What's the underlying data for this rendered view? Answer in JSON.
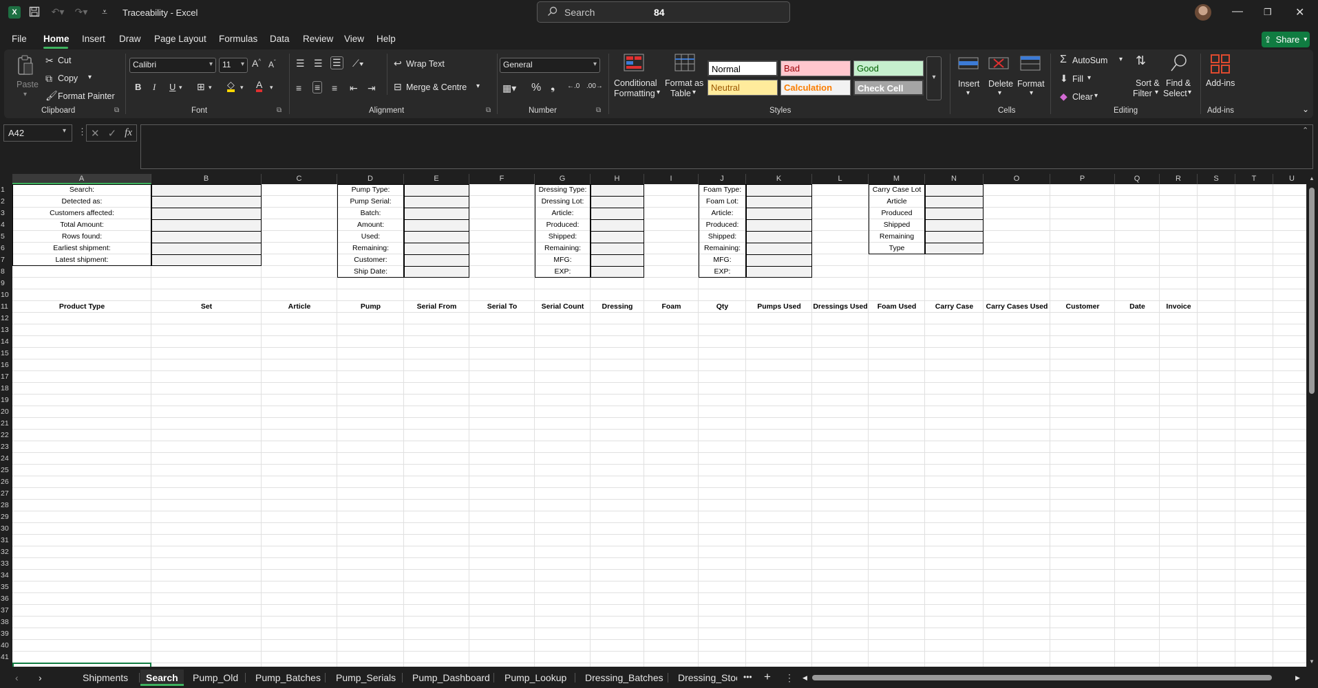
{
  "window": {
    "title": "Traceability  -  Excel",
    "search_placeholder": "Search",
    "search_value": "84"
  },
  "menu": {
    "items": [
      "File",
      "Home",
      "Insert",
      "Draw",
      "Page Layout",
      "Formulas",
      "Data",
      "Review",
      "View",
      "Help"
    ],
    "active": "Home",
    "share_label": "Share"
  },
  "ribbon": {
    "clipboard": {
      "paste": "Paste",
      "cut": "Cut",
      "copy": "Copy",
      "format_painter": "Format Painter",
      "group": "Clipboard"
    },
    "font": {
      "name": "Calibri",
      "size": "11",
      "group": "Font"
    },
    "alignment": {
      "wrap": "Wrap Text",
      "merge": "Merge & Centre",
      "group": "Alignment"
    },
    "number": {
      "format": "General",
      "group": "Number"
    },
    "styles": {
      "conditional_1": "Conditional",
      "conditional_2": "Formatting",
      "format_table_1": "Format as",
      "format_table_2": "Table",
      "normal": "Normal",
      "bad": "Bad",
      "good": "Good",
      "neutral": "Neutral",
      "calculation": "Calculation",
      "check_cell": "Check Cell",
      "group": "Styles"
    },
    "cells": {
      "insert": "Insert",
      "delete": "Delete",
      "format": "Format",
      "group": "Cells"
    },
    "editing": {
      "autosum": "AutoSum",
      "fill": "Fill",
      "clear": "Clear",
      "sort_1": "Sort &",
      "sort_2": "Filter",
      "find_1": "Find &",
      "find_2": "Select",
      "group": "Editing"
    },
    "addins": {
      "label": "Add-ins",
      "group": "Add-ins"
    }
  },
  "formula_bar": {
    "name_box": "A42",
    "formula": ""
  },
  "sheet": {
    "columns": [
      "A",
      "B",
      "C",
      "D",
      "E",
      "F",
      "G",
      "H",
      "I",
      "J",
      "K",
      "L",
      "M",
      "N",
      "O",
      "P",
      "Q",
      "R",
      "S",
      "T",
      "U"
    ],
    "rows": [
      "1",
      "2",
      "3",
      "4",
      "5",
      "6",
      "7",
      "8",
      "9",
      "10",
      "11",
      "12",
      "13",
      "14",
      "15",
      "16",
      "17",
      "18",
      "19",
      "20",
      "21",
      "22",
      "23",
      "24",
      "25",
      "26",
      "27",
      "28",
      "29",
      "30",
      "31",
      "32",
      "33",
      "34",
      "35",
      "36",
      "37",
      "38",
      "39",
      "40",
      "41"
    ],
    "block_a": [
      "Search:",
      "Detected as:",
      "Customers affected:",
      "Total Amount:",
      "Rows found:",
      "Earliest shipment:",
      "Latest shipment:"
    ],
    "block_d": [
      "Pump Type:",
      "Pump Serial:",
      "Batch:",
      "Amount:",
      "Used:",
      "Remaining:",
      "Customer:",
      "Ship Date:"
    ],
    "block_g": [
      "Dressing Type:",
      "Dressing Lot:",
      "Article:",
      "Produced:",
      "Shipped:",
      "Remaining:",
      "MFG:",
      "EXP:"
    ],
    "block_j": [
      "Foam Type:",
      "Foam Lot:",
      "Article:",
      "Produced:",
      "Shipped:",
      "Remaining:",
      "MFG:",
      "EXP:"
    ],
    "block_m": [
      "Carry Case Lot",
      "Article",
      "Produced",
      "Shipped",
      "Remaining",
      "Type"
    ],
    "headers_row11": [
      "Product Type",
      "Set",
      "Article",
      "Pump",
      "Serial From",
      "Serial To",
      "Serial Count",
      "Dressing",
      "Foam",
      "Qty",
      "Pumps Used",
      "Dressings Used",
      "Foam Used",
      "Carry Case",
      "Carry Cases Used",
      "Customer",
      "Date",
      "Invoice"
    ]
  },
  "tabs": {
    "items": [
      "Shipments",
      "Search",
      "Pump_Old",
      "Pump_Batches",
      "Pump_Serials",
      "Pump_Dashboard",
      "Pump_Lookup",
      "Dressing_Batches",
      "Dressing_Stoc"
    ],
    "active": "Search",
    "more": "•••",
    "add": "+"
  },
  "colors": {
    "accent": "#3fb35f",
    "share": "#107c41"
  }
}
